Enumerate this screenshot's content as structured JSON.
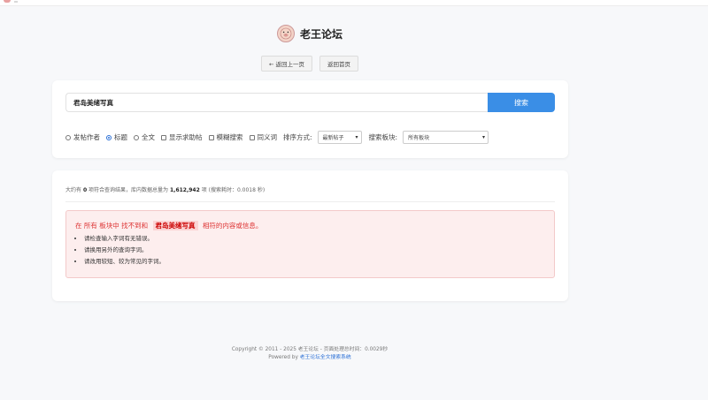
{
  "brand": {
    "title": "老王论坛",
    "logo_icon": "pig-face-icon"
  },
  "nav": {
    "back_label": "← 返回上一页",
    "home_label": "返回首页"
  },
  "search": {
    "query": "君岛美绪写真",
    "button_label": "搜索"
  },
  "options": {
    "scope": [
      {
        "label": "发帖作者",
        "checked": false
      },
      {
        "label": "标题",
        "checked": true
      },
      {
        "label": "全文",
        "checked": false
      }
    ],
    "checks": [
      {
        "label": "显示求助帖",
        "checked": false
      },
      {
        "label": "模糊搜索",
        "checked": false
      },
      {
        "label": "同义词",
        "checked": false
      }
    ],
    "sort_label": "排序方式:",
    "sort_value": "最新帖子",
    "board_label": "搜索板块:",
    "board_value": "所有板块"
  },
  "stats": {
    "prefix": "大约有",
    "count": "0",
    "middle": "项符合查询结果，库内数据总量为",
    "total": "1,612,942",
    "suffix": "项 (搜索耗时：0.0018 秒)"
  },
  "notice": {
    "prefix": "在 所有 板块中 找不到和",
    "keyword": "君岛美绪写真",
    "suffix": "相符的内容或信息。",
    "tips": [
      "请检查输入字词有无错误。",
      "请换用另外的查询字词。",
      "请改用较短、较为常见的字词。"
    ]
  },
  "footer": {
    "line1": "Copyright © 2011 - 2025 老王论坛 - 页面处理总时间：0.0029秒",
    "powered_prefix": "Powered by",
    "powered_link": "老王论坛全文搜索系统"
  },
  "colors": {
    "accent": "#3a8ee6",
    "alert_text": "#dd3333",
    "alert_bg": "#fdeeee"
  }
}
